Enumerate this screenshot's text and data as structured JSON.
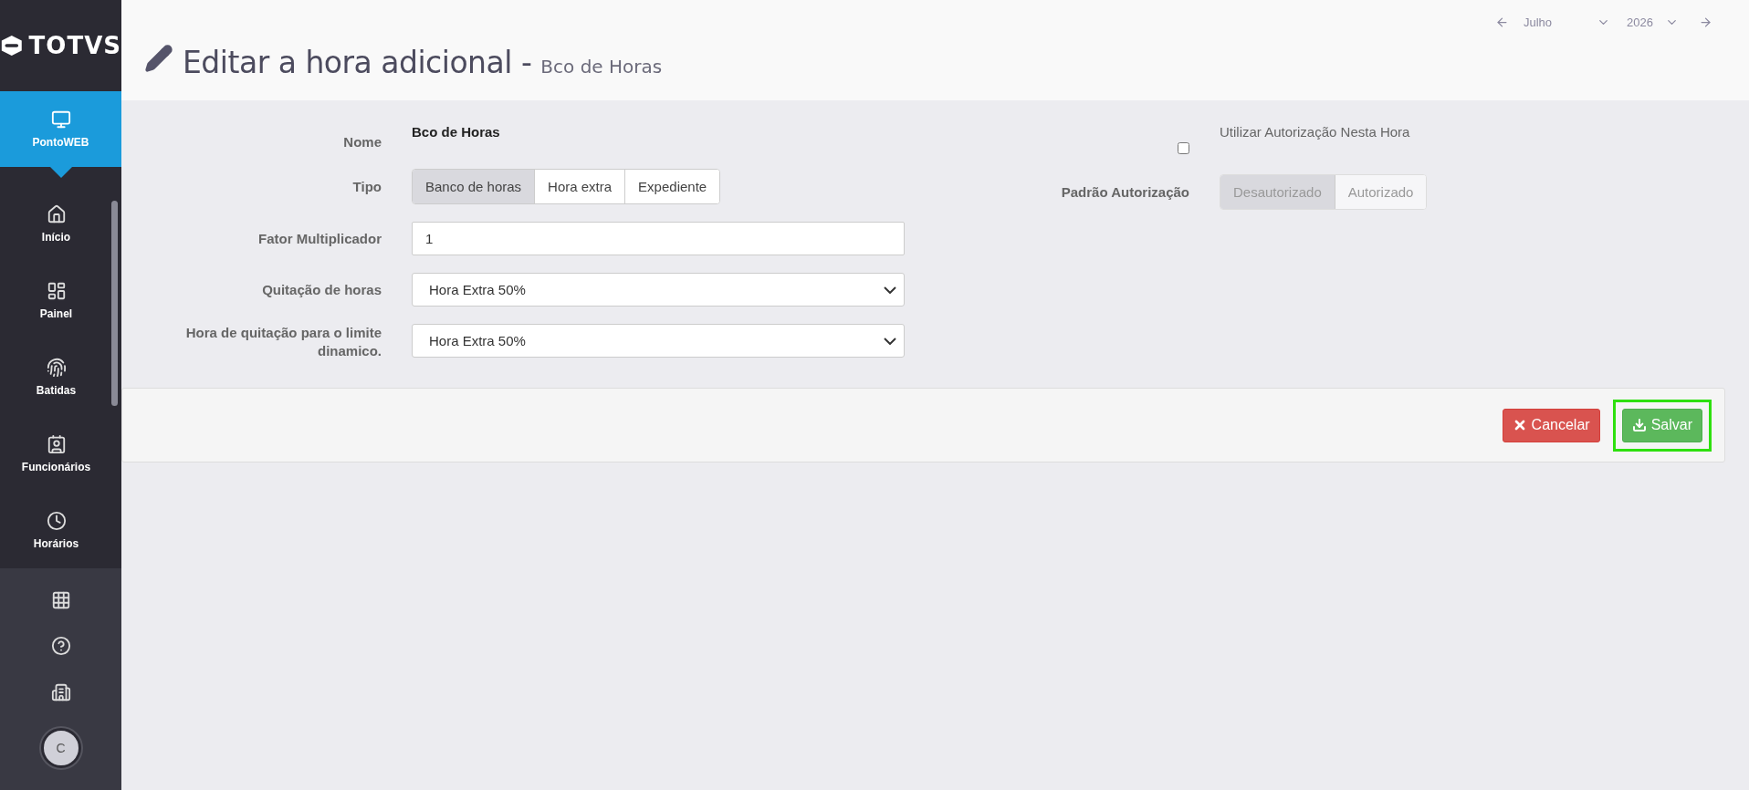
{
  "sidebar": {
    "logo": "TOTVS",
    "items": [
      {
        "label": "PontoWEB",
        "selected": true
      },
      {
        "label": "Início",
        "selected": false
      },
      {
        "label": "Painel",
        "selected": false
      },
      {
        "label": "Batidas",
        "selected": false
      },
      {
        "label": "Funcionários",
        "selected": false
      },
      {
        "label": "Horários",
        "selected": false
      }
    ],
    "avatar": "C"
  },
  "date_nav": {
    "month": "Julho",
    "year": "2026"
  },
  "header": {
    "title": "Editar a hora adicional -",
    "subtitle": "Bco de Horas"
  },
  "form": [
    {
      "kind": "static",
      "label": "Nome",
      "value": "Bco de Horas"
    },
    {
      "kind": "segmented",
      "label": "Tipo",
      "options": [
        {
          "label": "Banco de horas",
          "selected": true
        },
        {
          "label": "Hora extra",
          "selected": false
        },
        {
          "label": "Expediente",
          "selected": false
        }
      ]
    },
    {
      "kind": "input",
      "label": "Fator Multiplicador",
      "value": "1"
    },
    {
      "kind": "select",
      "label": "Quitação de horas",
      "value": "Hora Extra 50%"
    },
    {
      "kind": "select",
      "label": "Hora de quitação para o limite dinamico.",
      "value": "Hora Extra 50%"
    }
  ],
  "authorization": {
    "checkbox": {
      "label": "Utilizar Autorização Nesta Hora",
      "checked": false
    },
    "default": {
      "label": "Padrão Autorização",
      "disabled": true,
      "options": [
        {
          "label": "Desautorizado",
          "selected": true
        },
        {
          "label": "Autorizado",
          "selected": false
        }
      ]
    }
  },
  "buttons": [
    {
      "label": "Cancelar",
      "kind": "danger",
      "highlighted": false
    },
    {
      "label": "Salvar",
      "kind": "success",
      "highlighted": true
    }
  ]
}
